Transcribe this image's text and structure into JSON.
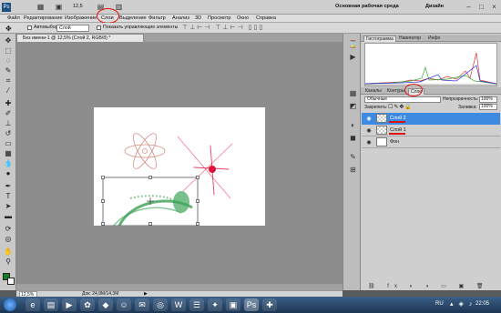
{
  "app": {
    "workspace": "Основная рабочая среда",
    "design": "Дизайн",
    "zoom_box": "12,5",
    "menu": [
      "Файл",
      "Редактирование",
      "Изображение",
      "Слои",
      "Выделение",
      "Фильтр",
      "Анализ",
      "3D",
      "Просмотр",
      "Окно",
      "Справка"
    ]
  },
  "options_bar": {
    "autoselect_label": "Автовыбор:",
    "autoselect_value": "Слой",
    "show_controls": "Показать управляющие элементы"
  },
  "document": {
    "tab_title": "Без имени-1 @ 12,5% (Слой 2, RGB/8) *",
    "zoom": "12,5%",
    "doc_info": "Док: 24,9М/14,3М"
  },
  "panels": {
    "top_tabs": [
      "Гистограмма",
      "Навигатор",
      "Инфо"
    ],
    "layers_tabs": [
      "Каналы",
      "Контуры",
      "Слои"
    ],
    "blend_mode": "Обычные",
    "opacity_label": "Непрозрачность:",
    "opacity_value": "100%",
    "lock_label": "Закрепить:",
    "fill_label": "Заливка:",
    "fill_value": "100%",
    "layers": [
      {
        "name": "Слой 2",
        "selected": true
      },
      {
        "name": "Слой 1",
        "selected": false
      },
      {
        "name": "Фон",
        "selected": false
      }
    ]
  },
  "taskbar": {
    "lang": "RU",
    "time": "22:05"
  },
  "colors": {
    "annotation_red": "#e01010",
    "selected_layer": "#3d8ae3",
    "foreground_swatch": "#1a7d2a"
  }
}
